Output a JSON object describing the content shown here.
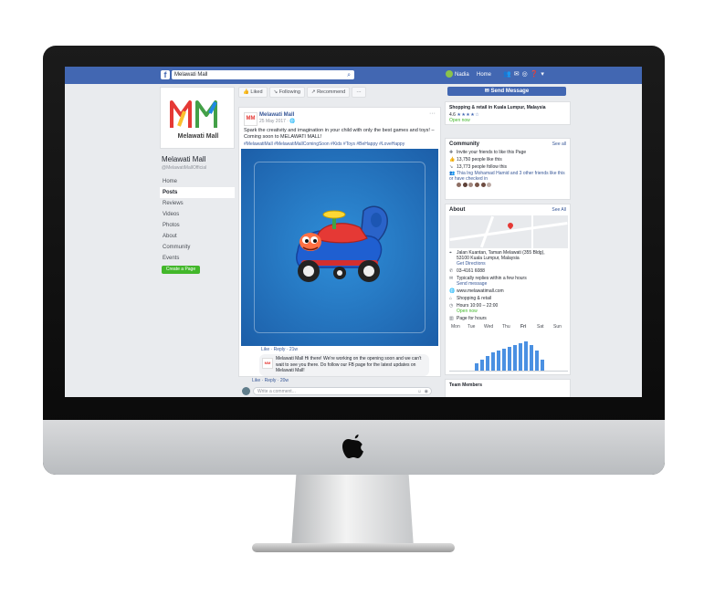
{
  "search": {
    "value": "Melawati Mall"
  },
  "topnav": {
    "user": "Nadia",
    "home": "Home"
  },
  "page": {
    "logo_initials": "MM",
    "logo_text": "Melawati Mall",
    "name": "Melawati Mall",
    "handle": "@MelawatiMallOfficial"
  },
  "sidebar": {
    "items": [
      {
        "label": "Home"
      },
      {
        "label": "Posts"
      },
      {
        "label": "Reviews"
      },
      {
        "label": "Videos"
      },
      {
        "label": "Photos"
      },
      {
        "label": "About"
      },
      {
        "label": "Community"
      },
      {
        "label": "Events"
      }
    ],
    "create_page": "Create a Page"
  },
  "actions": {
    "liked": "Liked",
    "following": "Following",
    "recommend": "Recommend",
    "more": "···"
  },
  "post": {
    "author": "Melawati Mall",
    "date": "25 May 2017 · ",
    "text": "Spark the creativity and imagination in your child with only the best games and toys! – Coming soon to MELAWATI MALL!",
    "tags": "#MelawatiMall #MelawatiMallComingSoon #Kids #Toys #BeHappy #LoveHappy",
    "like_row": "Like · Reply · 21w",
    "comment": "Melawati Mall Hi there! We're working on the opening soon and we can't wait to see you there. Do follow our FB page for the latest updates on Melawati Mall!",
    "comment_like_row": "Like · Reply · 20w",
    "write_comment": "Write a comment..."
  },
  "right": {
    "send_message": "Send Message",
    "category": "Shopping & retail in Kuala Lumpur, Malaysia",
    "rating": "4.6",
    "open_now_top": "Open now",
    "community": {
      "title": "Community",
      "see_all": "See all",
      "lines": [
        "Invite your friends to like this Page",
        "13,750 people like this",
        "13,773 people follow this",
        "Thia Ing Mohamad Hamid and 3 other friends like this or have checked in"
      ]
    },
    "about": {
      "title": "About",
      "see_all": "See All",
      "lines": [
        "Jalan Kuantan, Taman Melawati (355 Bldg),",
        "53100 Kuala Lumpur, Malaysia",
        "Get Directions",
        "03-4161 6088",
        "Typically replies within a few hours",
        "Send message",
        "www.melawatimall.com",
        "Shopping & retail",
        "Hours 10:00 – 22:00",
        "Open now",
        "Page for hours"
      ]
    },
    "hours_days": [
      "Mon",
      "Tue",
      "Wed",
      "Thu",
      "Fri",
      "Sat",
      "Sun"
    ],
    "team_members": "Team Members"
  }
}
